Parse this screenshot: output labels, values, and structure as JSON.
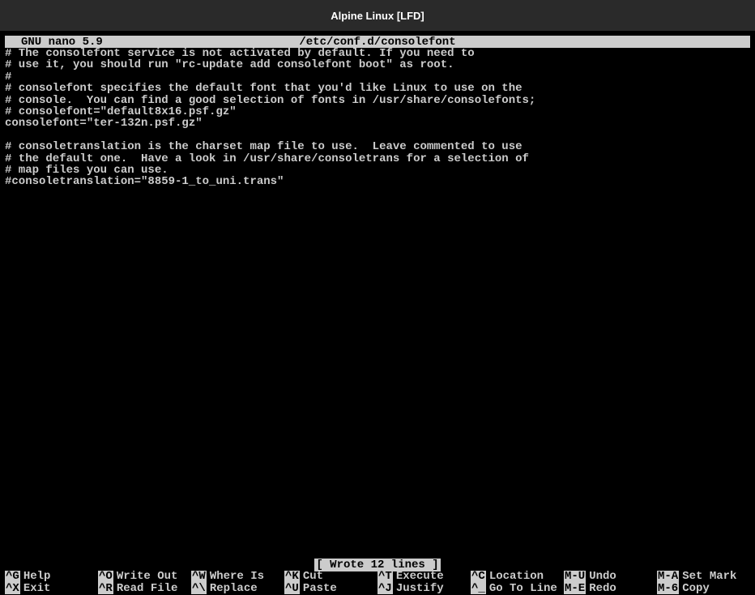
{
  "window": {
    "title": "Alpine Linux [LFD]"
  },
  "nano": {
    "version": "GNU nano 5.9",
    "filepath": "/etc/conf.d/consolefont",
    "status": "[ Wrote 12 lines ]",
    "content": "# The consolefont service is not activated by default. If you need to\n# use it, you should run \"rc-update add consolefont boot\" as root.\n#\n# consolefont specifies the default font that you'd like Linux to use on the\n# console.  You can find a good selection of fonts in /usr/share/consolefonts;\n# consolefont=\"default8x16.psf.gz\"\nconsolefont=\"ter-132n.psf.gz\"\n\n# consoletranslation is the charset map file to use.  Leave commented to use\n# the default one.  Have a look in /usr/share/consoletrans for a selection of\n# map files you can use.\n#consoletranslation=\"8859-1_to_uni.trans\""
  },
  "shortcuts": [
    {
      "key": "^G",
      "label": "Help"
    },
    {
      "key": "^O",
      "label": "Write Out"
    },
    {
      "key": "^W",
      "label": "Where Is"
    },
    {
      "key": "^K",
      "label": "Cut"
    },
    {
      "key": "^T",
      "label": "Execute"
    },
    {
      "key": "^C",
      "label": "Location"
    },
    {
      "key": "M-U",
      "label": "Undo"
    },
    {
      "key": "M-A",
      "label": "Set Mark"
    },
    {
      "key": "^X",
      "label": "Exit"
    },
    {
      "key": "^R",
      "label": "Read File"
    },
    {
      "key": "^\\",
      "label": "Replace"
    },
    {
      "key": "^U",
      "label": "Paste"
    },
    {
      "key": "^J",
      "label": "Justify"
    },
    {
      "key": "^_",
      "label": "Go To Line"
    },
    {
      "key": "M-E",
      "label": "Redo"
    },
    {
      "key": "M-6",
      "label": "Copy"
    }
  ]
}
